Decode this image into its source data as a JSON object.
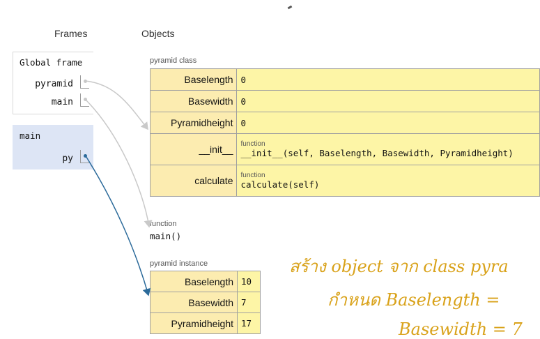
{
  "headers": {
    "frames": "Frames",
    "objects": "Objects"
  },
  "global_frame": {
    "title": "Global frame",
    "vars": [
      {
        "name": "pyramid"
      },
      {
        "name": "main"
      }
    ]
  },
  "main_frame": {
    "title": "main",
    "vars": [
      {
        "name": "py"
      }
    ]
  },
  "pyramid_class": {
    "label": "pyramid class",
    "rows": [
      {
        "key": "Baselength",
        "value": "0"
      },
      {
        "key": "Basewidth",
        "value": "0"
      },
      {
        "key": "Pyramidheight",
        "value": "0"
      },
      {
        "key": "__init__",
        "fn_label": "function",
        "value": "__init__(self, Baselength, Basewidth, Pyramidheight)"
      },
      {
        "key": "calculate",
        "fn_label": "function",
        "value": "calculate(self)"
      }
    ]
  },
  "main_function": {
    "label": "function",
    "signature": "main()"
  },
  "pyramid_instance": {
    "label": "pyramid instance",
    "rows": [
      {
        "key": "Baselength",
        "value": "10"
      },
      {
        "key": "Basewidth",
        "value": "7"
      },
      {
        "key": "Pyramidheight",
        "value": "17"
      }
    ]
  },
  "annotation": {
    "line1": "สร้าง object จาก class pyra",
    "line2": "กำหนด Baselength =",
    "line3": "Basewidth = 7"
  },
  "colors": {
    "pointer_gray": "#c9c9c9",
    "pointer_active": "#2b6a9a",
    "object_fill": "#fdf5a6",
    "active_frame_bg": "#dde5f5",
    "annotation": "#d9a21a"
  }
}
